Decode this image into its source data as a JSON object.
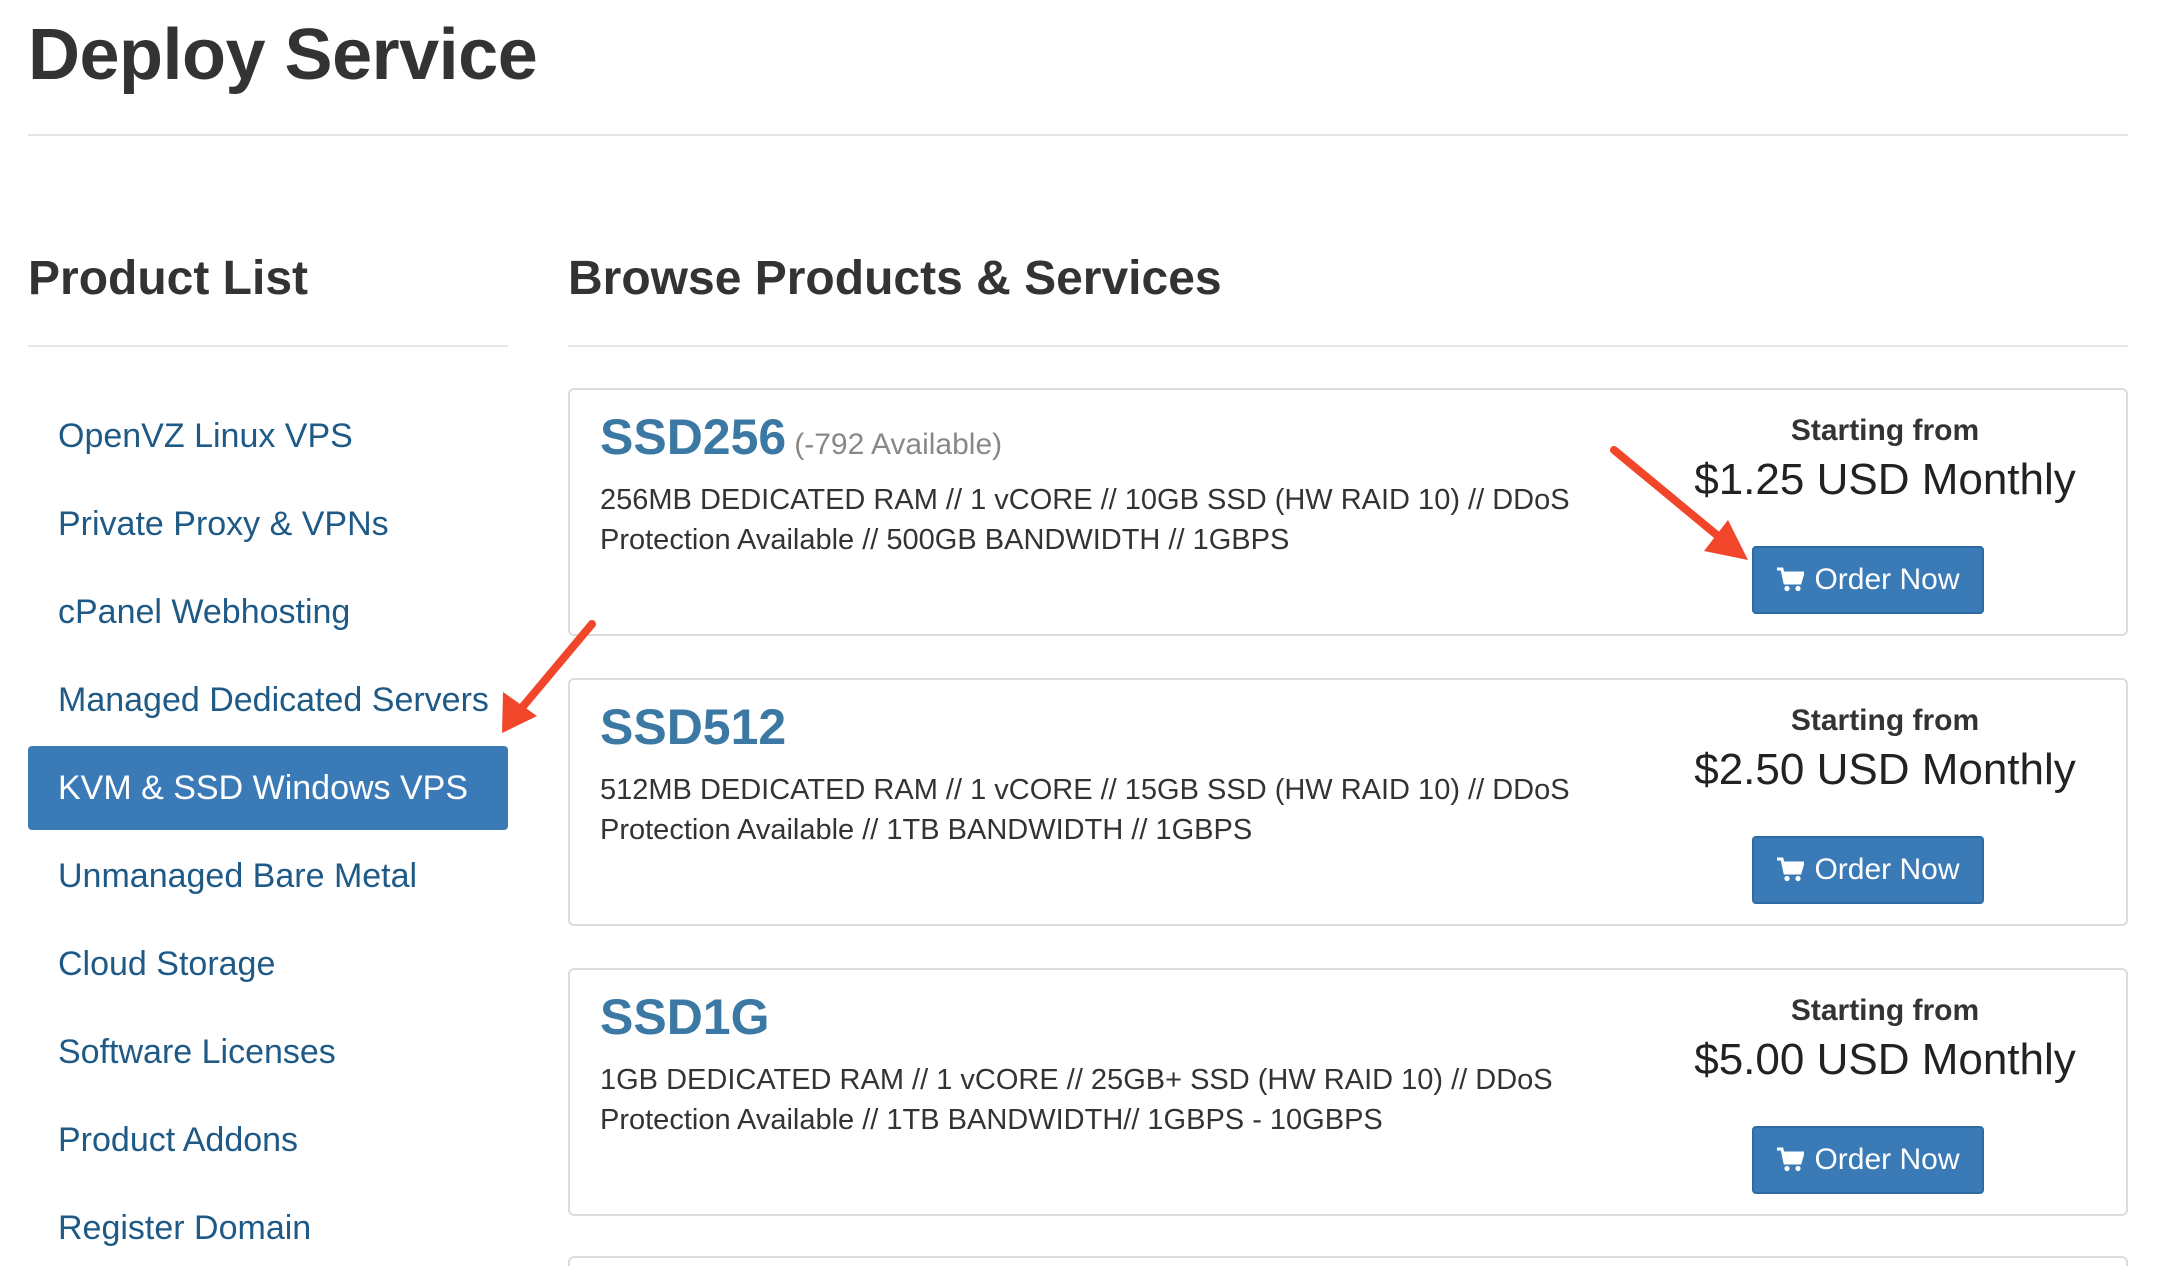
{
  "page": {
    "title": "Deploy Service"
  },
  "sidebar": {
    "heading": "Product List",
    "items": [
      {
        "label": "OpenVZ Linux VPS"
      },
      {
        "label": "Private Proxy & VPNs"
      },
      {
        "label": "cPanel Webhosting"
      },
      {
        "label": "Managed Dedicated Servers"
      },
      {
        "label": "KVM & SSD Windows VPS",
        "active": true
      },
      {
        "label": "Unmanaged Bare Metal"
      },
      {
        "label": "Cloud Storage"
      },
      {
        "label": "Software Licenses"
      },
      {
        "label": "Product Addons"
      },
      {
        "label": "Register Domain"
      }
    ]
  },
  "main": {
    "heading": "Browse Products & Services",
    "products": [
      {
        "name": "SSD256",
        "availability": "(-792 Available)",
        "description": "256MB DEDICATED RAM // 1 vCORE // 10GB SSD (HW RAID 10) // DDoS Protection Available // 500GB BANDWIDTH // 1GBPS",
        "starting_from": "Starting from",
        "price": "$1.25 USD Monthly",
        "order_label": "Order Now"
      },
      {
        "name": "SSD512",
        "availability": "",
        "description": "512MB DEDICATED RAM // 1 vCORE // 15GB SSD (HW RAID 10) // DDoS Protection Available // 1TB BANDWIDTH // 1GBPS",
        "starting_from": "Starting from",
        "price": "$2.50 USD Monthly",
        "order_label": "Order Now"
      },
      {
        "name": "SSD1G",
        "availability": "",
        "description": "1GB DEDICATED RAM // 1 vCORE // 25GB+ SSD (HW RAID 10) // DDoS Protection Available // 1TB BANDWIDTH// 1GBPS - 10GBPS",
        "starting_from": "Starting from",
        "price": "$5.00 USD Monthly",
        "order_label": "Order Now"
      }
    ]
  },
  "icons": {
    "order_button_icon": "shopping-cart-icon",
    "annotation_arrows": "red-arrow-icon"
  },
  "colors": {
    "accent": "#3a7ab7",
    "link": "#1f5a87",
    "product_name": "#3b78a3",
    "annotation": "#f2462a"
  }
}
